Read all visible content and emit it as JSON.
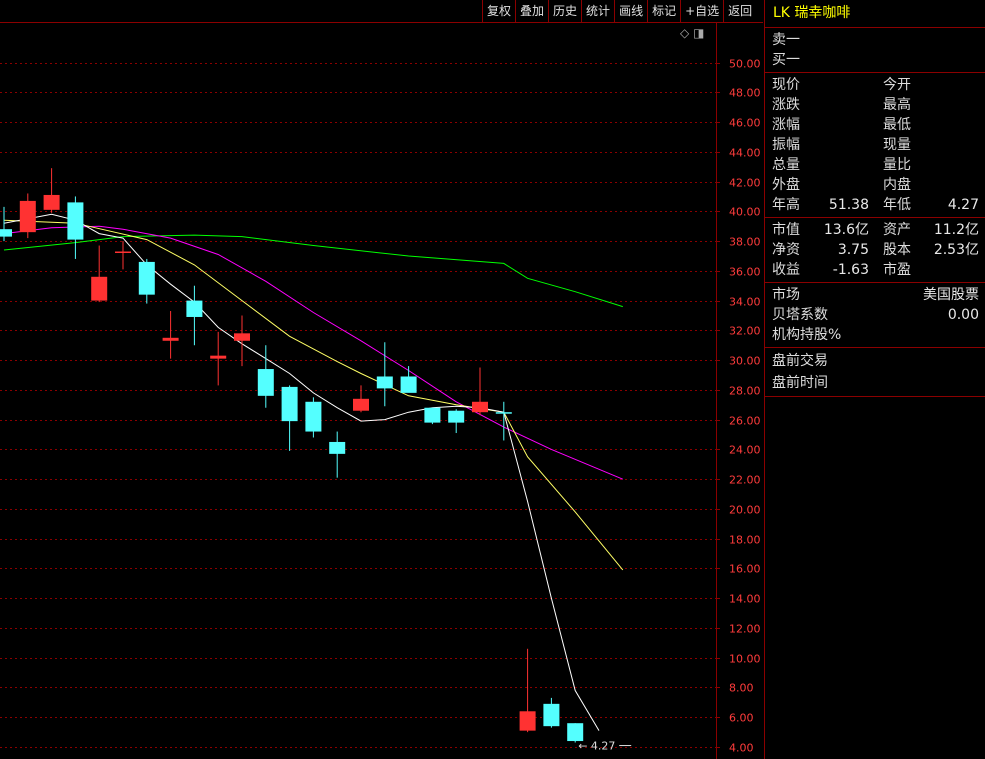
{
  "toolbar": {
    "buttons": [
      "复权",
      "叠加",
      "历史",
      "统计",
      "画线",
      "标记",
      "+自选",
      "返回"
    ]
  },
  "panel": {
    "title": "LK 瑞幸咖啡",
    "order_book": [
      "卖一",
      "买一"
    ],
    "quote": {
      "left": [
        "现价",
        "涨跌",
        "涨幅",
        "振幅",
        "总量",
        "外盘",
        "年高"
      ],
      "right": [
        "今开",
        "最高",
        "最低",
        "现量",
        "量比",
        "内盘",
        "年低"
      ],
      "year_high": "51.38",
      "year_low": "4.27"
    },
    "fundamentals": {
      "market_cap_label": "市值",
      "market_cap": "13.6亿",
      "assets_label": "资产",
      "assets": "11.2亿",
      "net_assets_label": "净资",
      "net_assets": "3.75",
      "shares_label": "股本",
      "shares": "2.53亿",
      "eps_label": "收益",
      "eps": "-1.63",
      "pe_label": "市盈",
      "pe": ""
    },
    "market": {
      "market_label": "市场",
      "market": "美国股票",
      "beta_label": "贝塔系数",
      "beta": "0.00",
      "inst_label": "机构持股%"
    },
    "premarket": {
      "trade_label": "盘前交易",
      "time_label": "盘前时间"
    }
  },
  "colors": {
    "up": "#ff3232",
    "down": "#54ffff",
    "grid": "#8b0000",
    "axis_text": "#ff3c3c",
    "ma5": "#ffffff",
    "ma10": "#ffff66",
    "ma20": "#ff00ff",
    "ma60": "#00ff00",
    "title": "#ffff00"
  },
  "chart_data": {
    "type": "candlestick",
    "ylim": [
      3,
      52
    ],
    "y_ticks": [
      "4.00",
      "6.00",
      "8.00",
      "10.00",
      "12.00",
      "14.00",
      "16.00",
      "18.00",
      "20.00",
      "22.00",
      "24.00",
      "26.00",
      "28.00",
      "30.00",
      "32.00",
      "34.00",
      "36.00",
      "38.00",
      "40.00",
      "42.00",
      "44.00",
      "46.00",
      "48.00",
      "50.00"
    ],
    "low_marker": "4.27",
    "candles": [
      {
        "o": 38.8,
        "h": 40.3,
        "l": 38.0,
        "c": 38.3
      },
      {
        "o": 38.6,
        "h": 41.2,
        "l": 38.2,
        "c": 40.7
      },
      {
        "o": 40.1,
        "h": 42.9,
        "l": 39.9,
        "c": 41.1
      },
      {
        "o": 40.6,
        "h": 41.0,
        "l": 36.8,
        "c": 38.1
      },
      {
        "o": 34.0,
        "h": 37.7,
        "l": 33.9,
        "c": 35.6
      },
      {
        "o": 37.3,
        "h": 38.0,
        "l": 36.1,
        "c": 37.3
      },
      {
        "o": 36.6,
        "h": 36.8,
        "l": 33.8,
        "c": 34.4
      },
      {
        "o": 31.3,
        "h": 33.3,
        "l": 30.1,
        "c": 31.5
      },
      {
        "o": 34.0,
        "h": 35.0,
        "l": 31.0,
        "c": 32.9
      },
      {
        "o": 30.1,
        "h": 31.9,
        "l": 28.3,
        "c": 30.3
      },
      {
        "o": 31.3,
        "h": 33.0,
        "l": 29.6,
        "c": 31.8
      },
      {
        "o": 29.4,
        "h": 31.0,
        "l": 26.8,
        "c": 27.6
      },
      {
        "o": 28.2,
        "h": 28.3,
        "l": 23.9,
        "c": 25.9
      },
      {
        "o": 27.2,
        "h": 27.5,
        "l": 24.8,
        "c": 25.2
      },
      {
        "o": 24.5,
        "h": 25.2,
        "l": 22.1,
        "c": 23.7
      },
      {
        "o": 26.6,
        "h": 28.3,
        "l": 26.5,
        "c": 27.4
      },
      {
        "o": 28.9,
        "h": 31.2,
        "l": 26.9,
        "c": 28.1
      },
      {
        "o": 28.9,
        "h": 29.6,
        "l": 27.9,
        "c": 27.8
      },
      {
        "o": 26.8,
        "h": 26.8,
        "l": 25.7,
        "c": 25.8
      },
      {
        "o": 26.6,
        "h": 26.7,
        "l": 25.1,
        "c": 25.8
      },
      {
        "o": 26.5,
        "h": 29.5,
        "l": 26.3,
        "c": 27.2
      },
      {
        "o": 26.5,
        "h": 27.2,
        "l": 24.6,
        "c": 26.4
      },
      {
        "o": 5.1,
        "h": 10.6,
        "l": 5.0,
        "c": 6.4
      },
      {
        "o": 6.9,
        "h": 7.3,
        "l": 5.3,
        "c": 5.4
      },
      {
        "o": 5.6,
        "h": 5.6,
        "l": 4.3,
        "c": 4.4
      }
    ],
    "ma5": [
      [
        0,
        39.2
      ],
      [
        1,
        39.5
      ],
      [
        2,
        39.8
      ],
      [
        3,
        39.4
      ],
      [
        4,
        38.5
      ],
      [
        5,
        38.2
      ],
      [
        6,
        36.4
      ],
      [
        7,
        35.1
      ],
      [
        8,
        33.9
      ],
      [
        9,
        32.2
      ],
      [
        10,
        31.1
      ],
      [
        11,
        30.1
      ],
      [
        12,
        29.1
      ],
      [
        13,
        27.8
      ],
      [
        14,
        26.8
      ],
      [
        15,
        25.9
      ],
      [
        16,
        26.0
      ],
      [
        17,
        26.5
      ],
      [
        18,
        26.8
      ],
      [
        19,
        26.9
      ],
      [
        20,
        26.8
      ],
      [
        21,
        26.5
      ],
      [
        22,
        20.5
      ],
      [
        23,
        14.0
      ],
      [
        24,
        7.8
      ],
      [
        25,
        5.1
      ]
    ],
    "ma10": [
      [
        0,
        39.4
      ],
      [
        3,
        39.2
      ],
      [
        6,
        38.1
      ],
      [
        8,
        36.4
      ],
      [
        10,
        34.0
      ],
      [
        12,
        31.6
      ],
      [
        14,
        29.9
      ],
      [
        15,
        29.1
      ],
      [
        17,
        27.6
      ],
      [
        19,
        27.0
      ],
      [
        21,
        26.5
      ],
      [
        22,
        23.5
      ],
      [
        24,
        19.8
      ],
      [
        26,
        15.9
      ]
    ],
    "ma20": [
      [
        0,
        38.5
      ],
      [
        2,
        38.9
      ],
      [
        4,
        39.0
      ],
      [
        5,
        38.8
      ],
      [
        7,
        38.2
      ],
      [
        9,
        37.1
      ],
      [
        11,
        35.3
      ],
      [
        13,
        33.2
      ],
      [
        15,
        31.3
      ],
      [
        17,
        29.3
      ],
      [
        19,
        27.2
      ],
      [
        21,
        25.5
      ],
      [
        23,
        24.0
      ],
      [
        26,
        22.0
      ]
    ],
    "ma60": [
      [
        0,
        37.4
      ],
      [
        3,
        37.9
      ],
      [
        5,
        38.3
      ],
      [
        8,
        38.4
      ],
      [
        10,
        38.3
      ],
      [
        13,
        37.7
      ],
      [
        17,
        37.0
      ],
      [
        21,
        36.5
      ],
      [
        22,
        35.5
      ],
      [
        24,
        34.6
      ],
      [
        26,
        33.6
      ]
    ]
  }
}
